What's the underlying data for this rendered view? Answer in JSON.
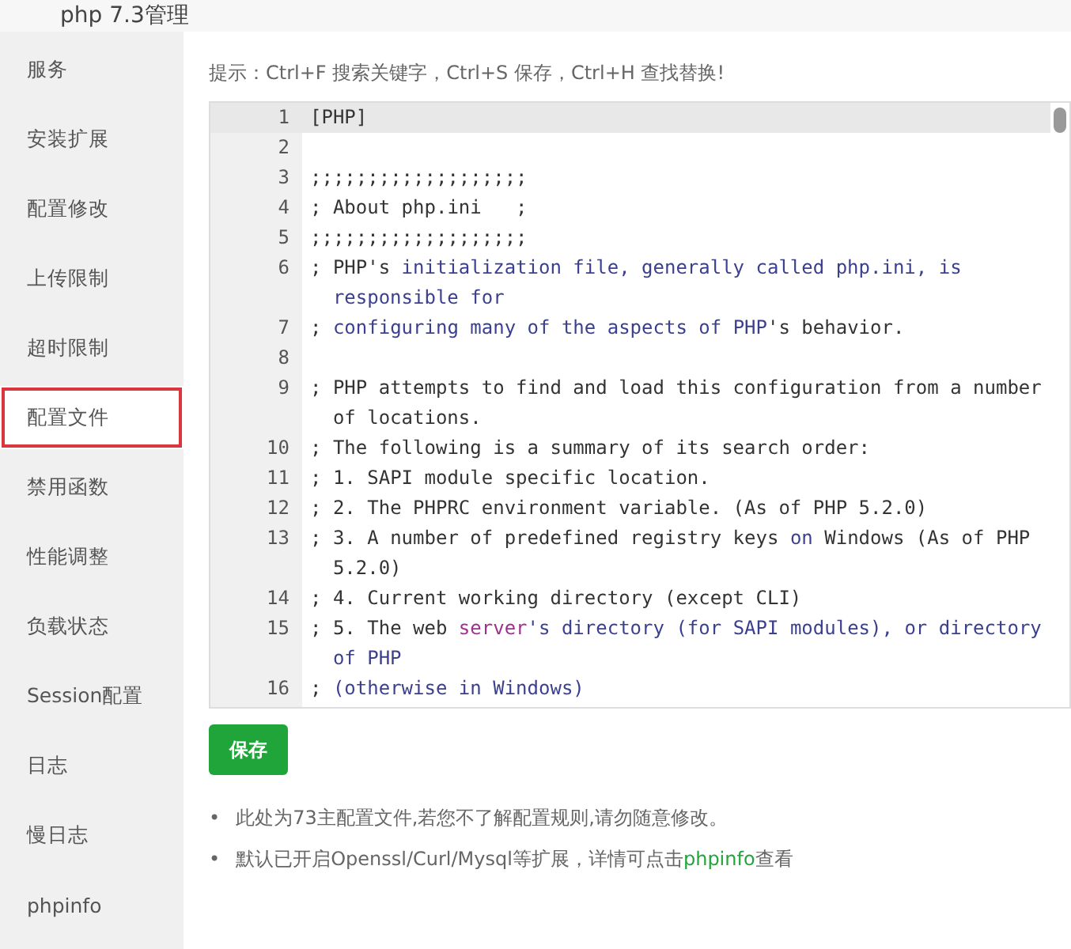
{
  "header": {
    "title": "php 7.3管理"
  },
  "sidebar": {
    "items": [
      {
        "label": "服务",
        "selected": false
      },
      {
        "label": "安装扩展",
        "selected": false
      },
      {
        "label": "配置修改",
        "selected": false
      },
      {
        "label": "上传限制",
        "selected": false
      },
      {
        "label": "超时限制",
        "selected": false
      },
      {
        "label": "配置文件",
        "selected": true
      },
      {
        "label": "禁用函数",
        "selected": false
      },
      {
        "label": "性能调整",
        "selected": false
      },
      {
        "label": "负载状态",
        "selected": false
      },
      {
        "label": "Session配置",
        "selected": false
      },
      {
        "label": "日志",
        "selected": false
      },
      {
        "label": "慢日志",
        "selected": false
      },
      {
        "label": "phpinfo",
        "selected": false
      }
    ]
  },
  "hint": "提示：Ctrl+F 搜索关键字，Ctrl+S 保存，Ctrl+H 查找替换!",
  "editor": {
    "lines": [
      {
        "number": "1",
        "active": true,
        "segments": [
          {
            "text": "[PHP]",
            "kind": "plain"
          }
        ]
      },
      {
        "number": "2",
        "active": false
      },
      {
        "number": "3",
        "active": false,
        "segments": [
          {
            "text": ";;;;;;;;;;;;;;;;;;;",
            "kind": "plain"
          }
        ]
      },
      {
        "number": "4",
        "active": false,
        "segments": [
          {
            "text": "; About php.ini   ;",
            "kind": "plain"
          }
        ]
      },
      {
        "number": "5",
        "active": false,
        "segments": [
          {
            "text": ";;;;;;;;;;;;;;;;;;;",
            "kind": "plain"
          }
        ]
      },
      {
        "number": "6",
        "active": false,
        "segments": [
          {
            "text": "; PHP's ",
            "kind": "plain"
          },
          {
            "text": "initialization file, generally called php.ini, is responsible for",
            "kind": "keyword"
          }
        ]
      },
      {
        "number": "7",
        "active": false,
        "segments": [
          {
            "text": "; ",
            "kind": "plain"
          },
          {
            "text": "configuring many of the aspects of PHP",
            "kind": "keyword"
          },
          {
            "text": "'s behavior.",
            "kind": "plain"
          }
        ]
      },
      {
        "number": "8",
        "active": false
      },
      {
        "number": "9",
        "active": false,
        "segments": [
          {
            "text": "; PHP attempts to find and load this configuration from a number of locations.",
            "kind": "plain"
          }
        ]
      },
      {
        "number": "10",
        "active": false,
        "segments": [
          {
            "text": "; The following is a summary of its search order:",
            "kind": "plain"
          }
        ]
      },
      {
        "number": "11",
        "active": false,
        "segments": [
          {
            "text": "; 1. SAPI module specific location.",
            "kind": "plain"
          }
        ]
      },
      {
        "number": "12",
        "active": false,
        "segments": [
          {
            "text": "; 2. The PHPRC environment variable. (As of PHP 5.2.0)",
            "kind": "plain"
          }
        ]
      },
      {
        "number": "13",
        "active": false,
        "segments": [
          {
            "text": "; 3. A number of predefined registry keys ",
            "kind": "plain"
          },
          {
            "text": "on",
            "kind": "keyword"
          },
          {
            "text": " Windows (As of PHP 5.2.0)",
            "kind": "plain"
          }
        ]
      },
      {
        "number": "14",
        "active": false,
        "segments": [
          {
            "text": "; 4. Current working directory (except CLI)",
            "kind": "plain"
          }
        ]
      },
      {
        "number": "15",
        "active": false,
        "segments": [
          {
            "text": "; 5. The web ",
            "kind": "plain"
          },
          {
            "text": "server",
            "kind": "string"
          },
          {
            "text": "'s directory (for SAPI modules), or directory of PHP",
            "kind": "keyword"
          }
        ]
      },
      {
        "number": "16",
        "active": false,
        "segments": [
          {
            "text": "; ",
            "kind": "plain"
          },
          {
            "text": "(otherwise in Windows)",
            "kind": "keyword"
          }
        ]
      }
    ]
  },
  "save_button": "保存",
  "notes": [
    {
      "bullet": "•",
      "text": "此处为73主配置文件,若您不了解配置规则,请勿随意修改。"
    },
    {
      "bullet": "•",
      "text": "默认已开启Openssl/Curl/Mysql等扩展，详情可点击",
      "link": "phpinfo",
      "after": "查看"
    }
  ]
}
